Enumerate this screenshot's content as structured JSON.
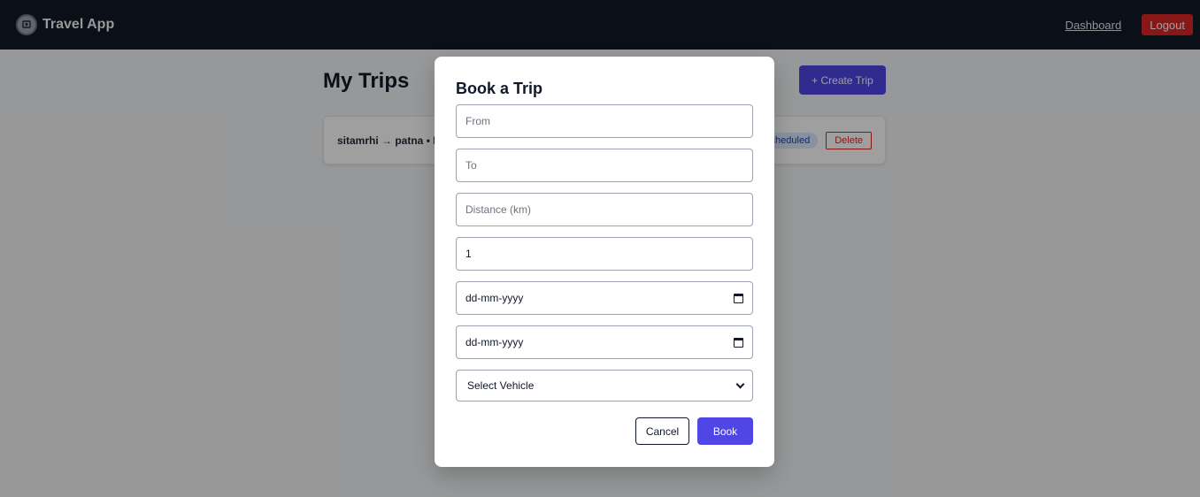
{
  "app": {
    "title": "Travel App"
  },
  "nav": {
    "dashboard": "Dashboard",
    "logout": "Logout"
  },
  "page": {
    "title": "My Trips",
    "create_button": "+ Create Trip",
    "trips": [
      {
        "route": "sitamrhi → patna • P",
        "status": "cheduled",
        "delete_label": "Delete"
      }
    ]
  },
  "modal": {
    "title": "Book a Trip",
    "from_placeholder": "From",
    "to_placeholder": "To",
    "distance_placeholder": "Distance (km)",
    "passengers_value": "1",
    "start_date": "dd-mm-yyyy",
    "end_date": "dd-mm-yyyy",
    "vehicle_select": "Select Vehicle",
    "cancel_label": "Cancel",
    "book_label": "Book"
  },
  "colors": {
    "primary": "#4f46e5",
    "danger": "#dc2626",
    "header": "#111827"
  },
  "icons": {
    "logo": "travel-logo-icon",
    "calendar": "calendar-icon",
    "dropdown": "chevron-down-icon"
  }
}
